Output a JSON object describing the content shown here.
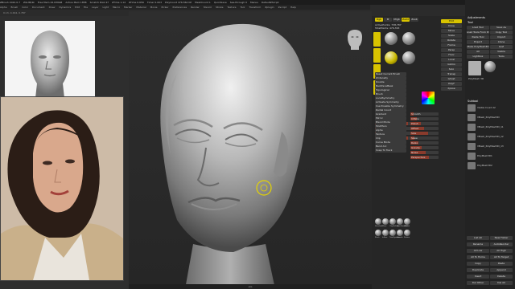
{
  "app": {
    "title": "ZBrush 2022.0.7",
    "topbar_items": [
      "ZBrush 2022.0.7",
      "ZGUM/4k",
      "Free Mem 44.636GB",
      "Active Mem 1858",
      "Scratch Disk 47",
      "ZTime 1.12",
      "RTime 0.656",
      "Timer 0.003",
      "PolyCount 476.562 KP",
      "MeshCount 1",
      "QuickSave",
      "See-through 0",
      "Menus",
      "DefaultZScript"
    ],
    "menu_items": [
      "Alpha",
      "Brush",
      "Color",
      "Document",
      "Draw",
      "Dynamics",
      "Edit",
      "File",
      "Layer",
      "Light",
      "Macro",
      "Marker",
      "Material",
      "Movie",
      "Picker",
      "Preferences",
      "Render",
      "Stencil",
      "Stroke",
      "Texture",
      "Tool",
      "Transform",
      "Zplugin",
      "Zscript",
      "Help"
    ],
    "status_text": "0.13, 0.294, 0.787"
  },
  "bottom_bar": {
    "text": "◄ ►"
  },
  "mid_panel": {
    "tabs": [
      "Rgb",
      "M",
      "Mrgb",
      "Zadd",
      "Zsub"
    ],
    "sliders": [
      {
        "label": "Z Intensity 100",
        "fill": 0.78
      },
      {
        "label": "Draw Size 40",
        "fill": 0.35
      },
      {
        "label": "Focal Shift 0",
        "fill": 0.5
      },
      {
        "label": "Rgb Intensity 100",
        "fill": 0.78
      }
    ],
    "stats": [
      "ActivePoints: 738,787",
      "TotalPoints: 476,363"
    ],
    "section_labels": [
      "Reset Current Brush",
      "Zintensity",
      "Double",
      "BackfaceMask",
      "Topological",
      "Brush",
      "LocalSymmetry",
      "Activate Symmetry",
      "Use Posable Symmetry",
      "Radial Count",
      "Gradient",
      "Mirror",
      "Blend Mode",
      "Modifiers",
      "Alpha",
      "Texture",
      "Clip",
      "Curve Mode",
      "Bend Arc",
      "Snap To Track"
    ],
    "brush_labels": [
      "Standard",
      "Move",
      "ClayBuildup",
      "DamStandard",
      "hPolish",
      "Pinch",
      "Inflate",
      "TrimDynamic",
      "Smooth",
      "Flatten"
    ],
    "right_column": [
      "Edit",
      "Draw",
      "Move",
      "Scale",
      "Rotate",
      "Frame",
      "Persp",
      "Floor",
      "Local",
      "Gizmo",
      "Solo",
      "Transp",
      "Ghost",
      "PolyF",
      "Xpose"
    ],
    "deform_labels": [
      "Smooth",
      "Inflate",
      "Polish",
      "Offset",
      "Size",
      "Skew",
      "Relax",
      "Gravity",
      "Noise",
      "Perspective"
    ]
  },
  "right_panel": {
    "header": [
      "Adjustments",
      "Tool"
    ],
    "buttons": [
      "Load Tool",
      "Save As",
      "Load Tools From Project",
      "Copy Tool",
      "Paste Tool",
      "Import",
      "Export",
      "Clone",
      "Make PolyMesh3D",
      "GoZ",
      "All",
      "Visible",
      "Lightbox",
      "Tools"
    ],
    "tool_label": "PolyMesh 3D",
    "subtool_title": "Subtool",
    "subtools": [
      "Visible Count 22",
      "VMesh_PolyMesh3D",
      "VMesh_PolyMesh3D_11",
      "VMesh_PolyMesh3D_12",
      "VMesh_PolyMesh3D_13",
      "PolyMesh3D1",
      "PolyMesh3D2"
    ],
    "list_buttons": [
      "List All",
      "New Folder",
      "Rename",
      "AutoReorder",
      "All Low",
      "All High",
      "All To Home",
      "All To Target",
      "Copy",
      "Paste",
      "Duplicate",
      "Append",
      "Insert",
      "Delete",
      "Del Other",
      "Del All"
    ]
  },
  "colors": {
    "accent_yellow": "#d8c300",
    "slider_fill": "#8a3b2c",
    "panel_bg": "#262626"
  },
  "icons": [
    "head-reference-icon",
    "photo-reference",
    "sphere-material-icon",
    "gyro-navigator-icon"
  ]
}
